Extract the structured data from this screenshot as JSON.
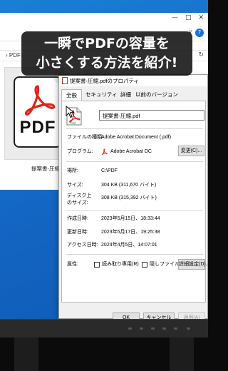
{
  "caption": {
    "line1": "一瞬でPDFの容量を",
    "line2": "小さくする方法を紹介!"
  },
  "explorer": {
    "address": "› PDF",
    "controls": {
      "minimize": "—",
      "maximize": "□",
      "close": "✕"
    },
    "help": "?",
    "chevron": "∨",
    "refresh": "↻",
    "file_tile": {
      "icon_text": "PDF",
      "name": "提案書-圧縮"
    }
  },
  "dialog": {
    "title": "提案書-圧縮.pdfのプロパティ",
    "tabs": [
      "全般",
      "セキュリティ",
      "詳細",
      "以前のバージョン"
    ],
    "active_tab": "全般",
    "file_name": "提案書-圧縮.pdf",
    "icon_label": "PDF",
    "rows": {
      "file_type": {
        "label": "ファイルの種類:",
        "value": "Adobe Acrobat Document (.pdf)"
      },
      "program": {
        "label": "プログラム:",
        "value": "Adobe Acrobat DC",
        "button": "変更(C)..."
      },
      "location": {
        "label": "場所:",
        "value": "C:\\PDF"
      },
      "size": {
        "label": "サイズ:",
        "value": "304 KB (311,670 バイト)"
      },
      "disk_size": {
        "label": "ディスク上\nのサイズ:",
        "value": "308 KB (315,392 バイト)"
      },
      "created": {
        "label": "作成日時:",
        "value": "2023年5月15日、18:33:44"
      },
      "modified": {
        "label": "更新日時:",
        "value": "2023年5月17日、19:25:38"
      },
      "accessed": {
        "label": "アクセス日時:",
        "value": "2024年4月5日、14:07:01"
      },
      "attributes": {
        "label": "属性:",
        "readonly": "読み取り専用(R)",
        "hidden": "隠しファイル(H)",
        "advanced": "詳細設定(D)..."
      }
    },
    "buttons": {
      "ok": "OK",
      "cancel": "キャンセル",
      "apply": "適用(A)"
    }
  }
}
